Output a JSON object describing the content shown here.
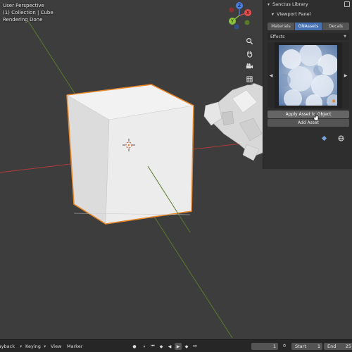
{
  "viewport": {
    "view_name": "User Perspective",
    "collection_info": "(1) Collection | Cube",
    "status": "Rendering Done"
  },
  "gizmo": {
    "axis_labels": [
      "X",
      "Y",
      "Z"
    ],
    "colors": {
      "x": "#e24c4c",
      "y": "#8cc43d",
      "z": "#4a7fe0"
    }
  },
  "nav_icons": [
    "zoom-icon",
    "hand-pan-icon",
    "camera-icon",
    "perspective-grid-icon"
  ],
  "panel": {
    "header": "Sanctus Library",
    "subpanel": "Viewport Panel",
    "tabs": [
      {
        "label": "Materials",
        "active": false
      },
      {
        "label": "GNAssets",
        "active": true
      },
      {
        "label": "Decals",
        "active": false
      }
    ],
    "category": "Effects",
    "apply_label": "Apply Asset to Object",
    "add_label": "Add Asset"
  },
  "timeline": {
    "playback_label": "Playback",
    "keying_label": "Keying",
    "view_label": "View",
    "marker_label": "Marker",
    "current_frame": "1",
    "start_label": "Start",
    "start_value": "1",
    "end_label": "End",
    "end_value": "25"
  },
  "colors": {
    "accent": "#4772b3",
    "selection_outline": "#e8862a",
    "viewport_bg": "#3d3d3d"
  }
}
